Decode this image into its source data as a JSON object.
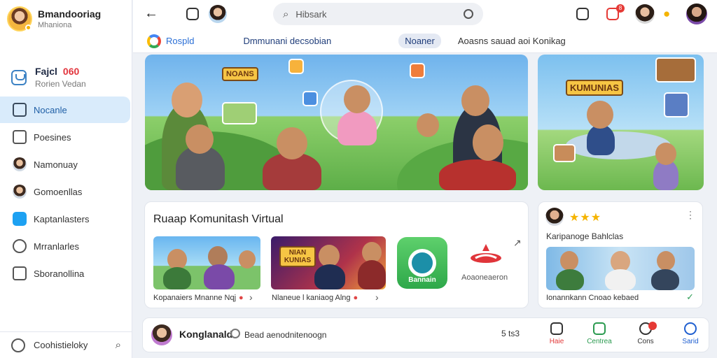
{
  "sidebar": {
    "profile": {
      "name": "Bmandooriag",
      "subtitle": "Mhaniona"
    },
    "feature": {
      "title": "Fajcl",
      "count": "060",
      "subtitle": "Rorien Vedan"
    },
    "items": [
      {
        "label": "Nocanle",
        "icon": "home-icon",
        "active": true
      },
      {
        "label": "Poesines",
        "icon": "calendar-icon",
        "active": false
      },
      {
        "label": "Namonuay",
        "icon": "person-avatar-icon",
        "active": false
      },
      {
        "label": "Gomoenllas",
        "icon": "group-avatar-icon",
        "active": false
      },
      {
        "label": "Kaptanlasters",
        "icon": "bird-icon",
        "active": false
      },
      {
        "label": "Mrranlarles",
        "icon": "people-icon",
        "active": false
      },
      {
        "label": "Sboranollina",
        "icon": "list-icon",
        "active": false
      }
    ],
    "footer": {
      "label": "Coohistieloky"
    }
  },
  "topbar": {
    "search_placeholder": "Hibsark",
    "badge_count": "8"
  },
  "subheader": {
    "brand": "Rospld",
    "title": "Dmmunani decsobian",
    "pill": "Noaner",
    "right": "Aoasns sauad aoi Konikag"
  },
  "banners": {
    "main_sign": "NOANS",
    "side_sign": "KUMUNIAS"
  },
  "community": {
    "heading": "Ruaap Komunitash Virtual",
    "cards": [
      {
        "caption": "Kopanaiers Mnanne Nqj"
      },
      {
        "caption": "Nlaneue l kaniaog Alng",
        "sign": "NIAN KUNIAS"
      }
    ],
    "app_tile_label": "Bannain",
    "partner_label": "Aoaoneaeron"
  },
  "rating_card": {
    "stars": "★★★",
    "title": "Karipanoge Bahlclas",
    "caption": "Ionannkann Cnoao kebaed"
  },
  "bottom_bar": {
    "user": "Konglanald",
    "message": "Bead aenodnitenoogn",
    "count": "5 ts3",
    "nav": [
      {
        "label": "Haie",
        "icon": "home-icon",
        "color": "#e23a3a"
      },
      {
        "label": "Centrea",
        "icon": "chart-icon",
        "color": "#2a9a4f"
      },
      {
        "label": "Cons",
        "icon": "clock-icon",
        "color": "#333333"
      },
      {
        "label": "Sarid",
        "icon": "circle-icon",
        "color": "#1f5fd0"
      }
    ]
  },
  "colors": {
    "accent": "#1f5fa6",
    "active_nav": "#d9ebfb",
    "badge": "#e53935",
    "star": "#f5b400"
  }
}
